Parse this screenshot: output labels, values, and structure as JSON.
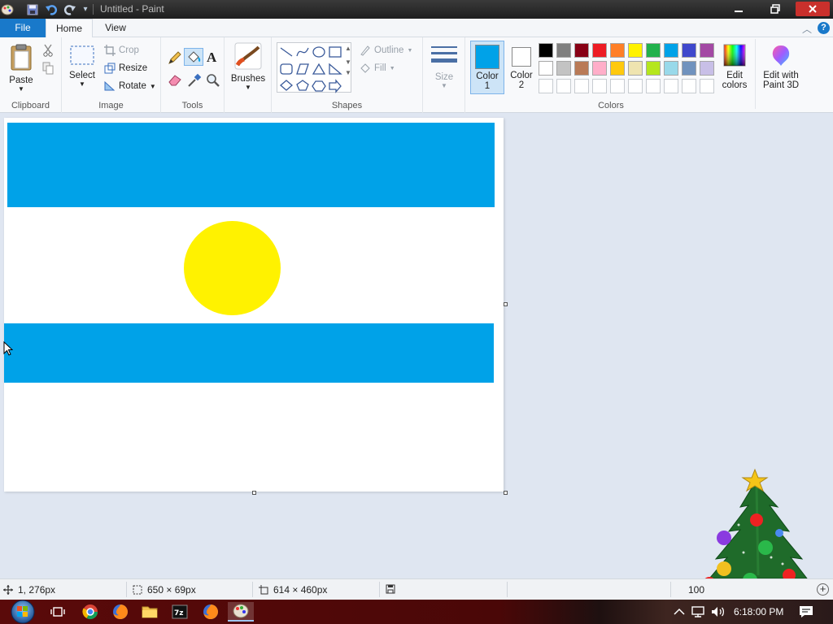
{
  "window": {
    "title": "Untitled - Paint"
  },
  "tabs": {
    "file": "File",
    "home": "Home",
    "view": "View"
  },
  "ribbon": {
    "clipboard": {
      "label": "Clipboard",
      "paste": "Paste"
    },
    "image": {
      "label": "Image",
      "select": "Select",
      "crop": "Crop",
      "resize": "Resize",
      "rotate": "Rotate"
    },
    "tools": {
      "label": "Tools"
    },
    "brushes": {
      "label": "Brushes"
    },
    "shapes": {
      "label": "Shapes",
      "outline": "Outline",
      "fill": "Fill"
    },
    "size": {
      "label": "Size"
    },
    "color1": {
      "label_line1": "Color",
      "label_line2": "1",
      "color": "#00a2e8"
    },
    "color2": {
      "label_line1": "Color",
      "label_line2": "2",
      "color": "#ffffff"
    },
    "colors": {
      "label": "Colors",
      "row1": [
        "#000000",
        "#7f7f7f",
        "#880015",
        "#ed1c24",
        "#ff7f27",
        "#fff200",
        "#22b14c",
        "#00a2e8",
        "#3f48cc",
        "#a349a4"
      ],
      "row2": [
        "#ffffff",
        "#c3c3c3",
        "#b97a57",
        "#ffaec9",
        "#ffc90e",
        "#efe4b0",
        "#b5e61d",
        "#99d9ea",
        "#7092be",
        "#c8bfe7"
      ]
    },
    "edit_colors": {
      "line1": "Edit",
      "line2": "colors"
    },
    "paint3d": {
      "line1": "Edit with",
      "line2": "Paint 3D"
    }
  },
  "canvas": {
    "flag_blue": "#00a2e8",
    "sun_yellow": "#fff200",
    "background": "#ffffff"
  },
  "status": {
    "cursor_pos": "1, 276px",
    "selection_size": "650 × 69px",
    "canvas_size": "614 × 460px",
    "zoom": "100"
  },
  "taskbar": {
    "clock": "6:18:00 PM"
  }
}
